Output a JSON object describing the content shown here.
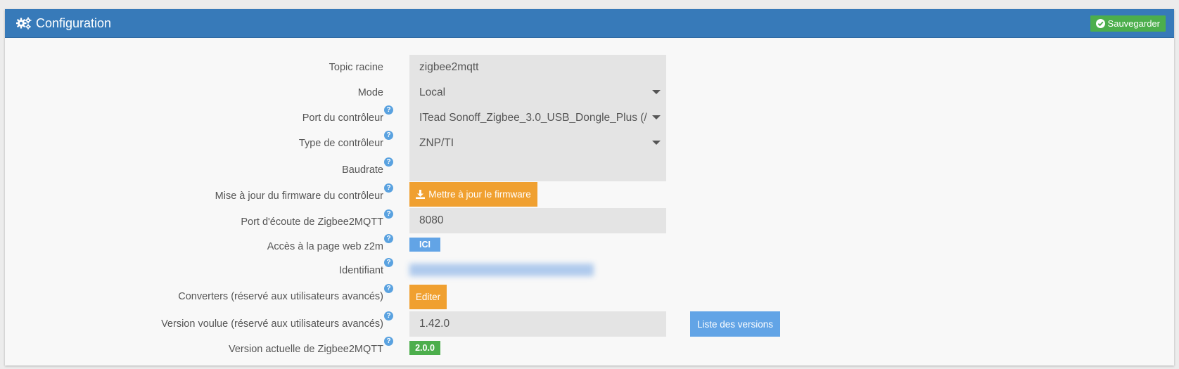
{
  "header": {
    "title": "Configuration",
    "title_icon": "gears-icon",
    "save_label": "Sauvegarder",
    "save_icon": "check-circle-icon",
    "color": "#377ab9"
  },
  "help_glyph": "?",
  "fields": {
    "topic_racine": {
      "label": "Topic racine",
      "value": "zigbee2mqtt"
    },
    "mode": {
      "label": "Mode",
      "value": "Local"
    },
    "port_controleur": {
      "label": "Port du contrôleur",
      "value": "ITead Sonoff_Zigbee_3.0_USB_Dongle_Plus (/"
    },
    "type_controleur": {
      "label": "Type de contrôleur",
      "value": "ZNP/TI"
    },
    "baudrate": {
      "label": "Baudrate",
      "value": ""
    },
    "firmware": {
      "label": "Mise à jour du firmware du contrôleur",
      "button": "Mettre à jour le firmware",
      "icon": "download-icon"
    },
    "port_ecoute": {
      "label": "Port d'écoute de Zigbee2MQTT",
      "value": "8080"
    },
    "page_web": {
      "label": "Accès à la page web z2m",
      "button": "ICI"
    },
    "identifiant": {
      "label": "Identifiant"
    },
    "converters": {
      "label": "Converters (réservé aux utilisateurs avancés)",
      "button": "Editer"
    },
    "version_voulue": {
      "label": "Version voulue (réservé aux utilisateurs avancés)",
      "value": "1.42.0",
      "button": "Liste des versions"
    },
    "version_actuelle": {
      "label": "Version actuelle de Zigbee2MQTT",
      "value": "2.0.0"
    }
  },
  "colors": {
    "orange": "#f0a030",
    "blue": "#62a4e6",
    "green": "#4cae4c"
  }
}
